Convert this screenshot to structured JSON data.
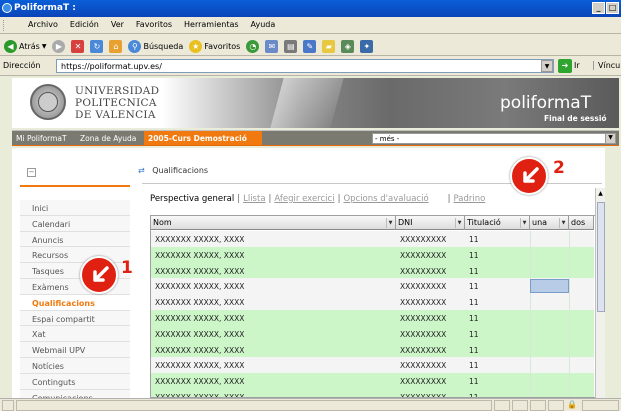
{
  "window": {
    "title": "PoliformaT :",
    "minimize": "_",
    "restore": "□"
  },
  "menu": [
    "Archivo",
    "Edición",
    "Ver",
    "Favoritos",
    "Herramientas",
    "Ayuda"
  ],
  "toolbar": {
    "back_label": "Atrás",
    "search_label": "Búsqueda",
    "favorites_label": "Favoritos"
  },
  "address": {
    "label": "Dirección",
    "url": "https://poliformat.upv.es/",
    "go_label": "Ir",
    "links_label": "Vínculos"
  },
  "header": {
    "university_line1": "UNIVERSIDAD",
    "university_line2": "POLITECNICA",
    "university_line3": "DE VALENCIA",
    "brand": "poliformaT",
    "logout": "Final de sessió"
  },
  "nav": {
    "items": [
      "Mi PoliformaT",
      "Zona de Ayuda"
    ],
    "active_site": "2005-Curs Demostració",
    "more_select": "- més -"
  },
  "sidebar": {
    "items": [
      "Inici",
      "Calendari",
      "Anuncis",
      "Recursos",
      "Tasques",
      "Exàmens",
      "Qualificacions",
      "Espai compartit",
      "Xat",
      "Webmail UPV",
      "Notícies",
      "Continguts",
      "Comunicacions"
    ],
    "current": "Qualificacions"
  },
  "main": {
    "title": "Qualificacions",
    "links": {
      "first": "Perspectiva general",
      "second": "Llista",
      "third": "Afegir exercici",
      "fourth": "Opcions d'avaluació",
      "fifth": "Padrino"
    },
    "columns": [
      "Nom",
      "DNI",
      "Titulació",
      "una",
      "dos"
    ],
    "rows": [
      {
        "name": "XXXXXXX XXXXX, XXXX",
        "dni": "XXXXXXXXX",
        "tit": "11",
        "color": "w"
      },
      {
        "name": "XXXXXXX XXXXX, XXXX",
        "dni": "XXXXXXXXX",
        "tit": "11",
        "color": "g"
      },
      {
        "name": "XXXXXXX XXXXX, XXXX",
        "dni": "XXXXXXXXX",
        "tit": "11",
        "color": "g"
      },
      {
        "name": "XXXXXXX XXXXX, XXXX",
        "dni": "XXXXXXXXX",
        "tit": "11",
        "color": "w"
      },
      {
        "name": "XXXXXXX XXXXX, XXXX",
        "dni": "XXXXXXXXX",
        "tit": "11",
        "color": "w"
      },
      {
        "name": "XXXXXXX XXXXX, XXXX",
        "dni": "XXXXXXXXX",
        "tit": "11",
        "color": "g"
      },
      {
        "name": "XXXXXXX XXXXX, XXXX",
        "dni": "XXXXXXXXX",
        "tit": "11",
        "color": "g"
      },
      {
        "name": "XXXXXXX XXXXX, XXXX",
        "dni": "XXXXXXXXX",
        "tit": "11",
        "color": "g"
      },
      {
        "name": "XXXXXXX XXXXX, XXXX",
        "dni": "XXXXXXXXX",
        "tit": "11",
        "color": "w"
      },
      {
        "name": "XXXXXXX XXXXX, XXXX",
        "dni": "XXXXXXXXX",
        "tit": "11",
        "color": "g"
      },
      {
        "name": "XXXXXXX XXXXX, XXXX",
        "dni": "XXXXXXXXX",
        "tit": "11",
        "color": "g"
      }
    ]
  },
  "annotations": [
    "1",
    "2"
  ],
  "colors": {
    "accent": "#f07a10",
    "title_bar": "#0a5fd8",
    "green_row": "#ccf5c8",
    "badge_red": "#e02010"
  }
}
